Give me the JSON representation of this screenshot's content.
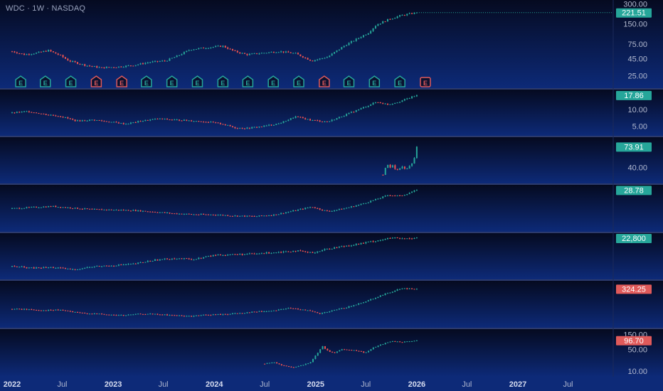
{
  "header": {
    "symbol": "WDC · 1W · NASDAQ"
  },
  "colors": {
    "up": "#26a69a",
    "down": "#ef5350",
    "badge_up": "#26a69a",
    "badge_down": "#e05a5a",
    "background_top": "#050a20",
    "background_bottom": "#0d2a78",
    "axis_text": "#b2b9cf",
    "separator": "#2c3a6c"
  },
  "chart_data": {
    "type": "candlestick",
    "x_axis": {
      "range": [
        "2022-01-01",
        "2027-12-01"
      ],
      "tick_labels": [
        "2022",
        "Jul",
        "2023",
        "Jul",
        "2024",
        "Jul",
        "2025",
        "Jul",
        "2026",
        "Jul",
        "2027",
        "Jul"
      ],
      "tick_dates": [
        "2022-01-01",
        "2022-07-01",
        "2023-01-01",
        "2023-07-01",
        "2024-01-01",
        "2024-07-01",
        "2025-01-01",
        "2025-07-01",
        "2026-01-01",
        "2026-07-01",
        "2027-01-01",
        "2027-07-01"
      ],
      "last_bar_date": "2026-01-01"
    },
    "panes": [
      {
        "id": "main",
        "scale": "log",
        "y_range": [
          18,
          310
        ],
        "tick_labels": [
          "300.00",
          "150.00",
          "75.00",
          "45.00",
          "25.00"
        ],
        "tick_values": [
          300,
          150,
          75,
          45,
          25
        ],
        "last_value": 221.51,
        "last_label": "221.51",
        "last_color": "up",
        "start_date": "2022-01-01",
        "points": [
          [
            0,
            58
          ],
          [
            0.03,
            52
          ],
          [
            0.06,
            55
          ],
          [
            0.09,
            60
          ],
          [
            0.12,
            50
          ],
          [
            0.14,
            42
          ],
          [
            0.18,
            36
          ],
          [
            0.22,
            33
          ],
          [
            0.26,
            34
          ],
          [
            0.3,
            36
          ],
          [
            0.34,
            40
          ],
          [
            0.38,
            42
          ],
          [
            0.41,
            50
          ],
          [
            0.44,
            62
          ],
          [
            0.48,
            66
          ],
          [
            0.52,
            70
          ],
          [
            0.55,
            58
          ],
          [
            0.58,
            52
          ],
          [
            0.62,
            55
          ],
          [
            0.66,
            58
          ],
          [
            0.7,
            54
          ],
          [
            0.74,
            42
          ],
          [
            0.78,
            48
          ],
          [
            0.82,
            70
          ],
          [
            0.86,
            95
          ],
          [
            0.88,
            110
          ],
          [
            0.9,
            145
          ],
          [
            0.93,
            175
          ],
          [
            0.96,
            200
          ],
          [
            1.0,
            221.51
          ]
        ],
        "earnings": [
          {
            "date": "2022-02-01",
            "kind": "E",
            "sentiment": "positive"
          },
          {
            "date": "2022-05-01",
            "kind": "E",
            "sentiment": "positive"
          },
          {
            "date": "2022-08-01",
            "kind": "E",
            "sentiment": "positive"
          },
          {
            "date": "2022-11-01",
            "kind": "E",
            "sentiment": "negative"
          },
          {
            "date": "2023-02-01",
            "kind": "E",
            "sentiment": "negative"
          },
          {
            "date": "2023-05-01",
            "kind": "E",
            "sentiment": "positive"
          },
          {
            "date": "2023-08-01",
            "kind": "E",
            "sentiment": "positive"
          },
          {
            "date": "2023-11-01",
            "kind": "E",
            "sentiment": "positive"
          },
          {
            "date": "2024-02-01",
            "kind": "E",
            "sentiment": "positive"
          },
          {
            "date": "2024-05-01",
            "kind": "E",
            "sentiment": "positive"
          },
          {
            "date": "2024-08-01",
            "kind": "E",
            "sentiment": "positive"
          },
          {
            "date": "2024-11-01",
            "kind": "E",
            "sentiment": "positive"
          },
          {
            "date": "2025-02-01",
            "kind": "E",
            "sentiment": "negative"
          },
          {
            "date": "2025-05-01",
            "kind": "E",
            "sentiment": "positive"
          },
          {
            "date": "2025-08-01",
            "kind": "E",
            "sentiment": "positive"
          },
          {
            "date": "2025-11-01",
            "kind": "E",
            "sentiment": "positive"
          },
          {
            "date": "2026-02-01",
            "kind": "E",
            "sentiment": "negative",
            "upcoming": true
          }
        ]
      },
      {
        "id": "pane2",
        "scale": "log",
        "y_range": [
          3.8,
          20
        ],
        "tick_labels": [
          "10.00",
          "5.00"
        ],
        "tick_values": [
          10,
          5
        ],
        "last_value": 17.86,
        "last_label": "17.86",
        "last_color": "up",
        "start_date": "2022-01-01",
        "points": [
          [
            0,
            8.6
          ],
          [
            0.04,
            9.2
          ],
          [
            0.08,
            8.2
          ],
          [
            0.12,
            7.5
          ],
          [
            0.16,
            6.2
          ],
          [
            0.2,
            6.5
          ],
          [
            0.24,
            6.0
          ],
          [
            0.28,
            5.5
          ],
          [
            0.32,
            6.2
          ],
          [
            0.36,
            6.8
          ],
          [
            0.4,
            6.5
          ],
          [
            0.44,
            6.3
          ],
          [
            0.48,
            6.0
          ],
          [
            0.52,
            5.5
          ],
          [
            0.55,
            4.7
          ],
          [
            0.58,
            4.6
          ],
          [
            0.62,
            5.0
          ],
          [
            0.66,
            5.6
          ],
          [
            0.7,
            7.4
          ],
          [
            0.74,
            6.4
          ],
          [
            0.78,
            6.0
          ],
          [
            0.82,
            7.8
          ],
          [
            0.86,
            10.2
          ],
          [
            0.9,
            13.5
          ],
          [
            0.93,
            12.2
          ],
          [
            0.96,
            14.0
          ],
          [
            1.0,
            17.86
          ]
        ]
      },
      {
        "id": "pane3",
        "scale": "log",
        "y_range": [
          27,
          90
        ],
        "tick_labels": [
          "40.00"
        ],
        "tick_values": [
          40
        ],
        "last_value": 73.91,
        "last_label": "73.91",
        "last_color": "up",
        "start_date": "2025-09-01",
        "points": [
          [
            0,
            32
          ],
          [
            0.1,
            44
          ],
          [
            0.2,
            40
          ],
          [
            0.3,
            43
          ],
          [
            0.4,
            36
          ],
          [
            0.5,
            39
          ],
          [
            0.6,
            41
          ],
          [
            0.7,
            37
          ],
          [
            0.8,
            42
          ],
          [
            0.9,
            46
          ],
          [
            1.0,
            73.91
          ]
        ]
      },
      {
        "id": "pane4",
        "scale": "log",
        "y_range": [
          5,
          32
        ],
        "tick_labels": [],
        "tick_values": [],
        "last_value": 28.78,
        "last_label": "28.78",
        "last_color": "up",
        "start_date": "2022-01-01",
        "points": [
          [
            0,
            12.5
          ],
          [
            0.05,
            13.2
          ],
          [
            0.1,
            13.8
          ],
          [
            0.15,
            12.8
          ],
          [
            0.2,
            12.0
          ],
          [
            0.25,
            11.8
          ],
          [
            0.3,
            11.5
          ],
          [
            0.35,
            10.8
          ],
          [
            0.4,
            10.0
          ],
          [
            0.45,
            9.6
          ],
          [
            0.5,
            9.5
          ],
          [
            0.55,
            9.0
          ],
          [
            0.6,
            8.8
          ],
          [
            0.65,
            9.5
          ],
          [
            0.7,
            11.5
          ],
          [
            0.74,
            13.5
          ],
          [
            0.78,
            11.0
          ],
          [
            0.82,
            12.5
          ],
          [
            0.86,
            15.0
          ],
          [
            0.9,
            19.0
          ],
          [
            0.93,
            23.0
          ],
          [
            0.96,
            22.0
          ],
          [
            1.0,
            28.78
          ]
        ]
      },
      {
        "id": "pane5",
        "scale": "log",
        "y_range": [
          6000,
          24000
        ],
        "tick_labels": [],
        "tick_values": [],
        "last_value": 22800,
        "last_label": "22,800",
        "last_color": "up",
        "start_date": "2022-01-01",
        "points": [
          [
            0,
            8500
          ],
          [
            0.05,
            8000
          ],
          [
            0.1,
            8200
          ],
          [
            0.15,
            7600
          ],
          [
            0.2,
            8400
          ],
          [
            0.25,
            8800
          ],
          [
            0.3,
            9200
          ],
          [
            0.35,
            10500
          ],
          [
            0.4,
            11200
          ],
          [
            0.45,
            10800
          ],
          [
            0.5,
            12500
          ],
          [
            0.55,
            12800
          ],
          [
            0.6,
            13000
          ],
          [
            0.65,
            13800
          ],
          [
            0.7,
            14500
          ],
          [
            0.74,
            13500
          ],
          [
            0.78,
            15500
          ],
          [
            0.82,
            17000
          ],
          [
            0.86,
            18500
          ],
          [
            0.9,
            20500
          ],
          [
            0.94,
            22500
          ],
          [
            0.97,
            21800
          ],
          [
            1.0,
            22800
          ]
        ]
      },
      {
        "id": "pane6",
        "scale": "log",
        "y_range": [
          55,
          420
        ],
        "tick_labels": [],
        "tick_values": [],
        "last_value": 324.25,
        "last_label": "324.25",
        "last_color": "down",
        "start_date": "2022-01-01",
        "points": [
          [
            0,
            120
          ],
          [
            0.04,
            118
          ],
          [
            0.08,
            112
          ],
          [
            0.12,
            115
          ],
          [
            0.16,
            100
          ],
          [
            0.2,
            96
          ],
          [
            0.24,
            90
          ],
          [
            0.28,
            88
          ],
          [
            0.32,
            95
          ],
          [
            0.36,
            92
          ],
          [
            0.4,
            88
          ],
          [
            0.44,
            84
          ],
          [
            0.48,
            90
          ],
          [
            0.52,
            92
          ],
          [
            0.56,
            98
          ],
          [
            0.6,
            105
          ],
          [
            0.64,
            110
          ],
          [
            0.68,
            125
          ],
          [
            0.72,
            118
          ],
          [
            0.76,
            95
          ],
          [
            0.8,
            115
          ],
          [
            0.84,
            140
          ],
          [
            0.88,
            185
          ],
          [
            0.92,
            250
          ],
          [
            0.96,
            330
          ],
          [
            1.0,
            324.25
          ]
        ]
      },
      {
        "id": "pane7",
        "scale": "log",
        "y_range": [
          8,
          180
        ],
        "tick_labels": [
          "150.00",
          "50.00",
          "10.00"
        ],
        "tick_values": [
          150,
          50,
          10
        ],
        "last_value": 96.7,
        "last_label": "96.70",
        "last_color": "down",
        "start_date": "2024-07-01",
        "points": [
          [
            0,
            17
          ],
          [
            0.06,
            19
          ],
          [
            0.12,
            15
          ],
          [
            0.18,
            13
          ],
          [
            0.24,
            15
          ],
          [
            0.3,
            19
          ],
          [
            0.34,
            34
          ],
          [
            0.38,
            62
          ],
          [
            0.42,
            42
          ],
          [
            0.46,
            38
          ],
          [
            0.5,
            50
          ],
          [
            0.56,
            48
          ],
          [
            0.62,
            44
          ],
          [
            0.66,
            38
          ],
          [
            0.72,
            58
          ],
          [
            0.78,
            75
          ],
          [
            0.84,
            92
          ],
          [
            0.9,
            85
          ],
          [
            0.95,
            90
          ],
          [
            1.0,
            96.7
          ]
        ]
      }
    ]
  }
}
